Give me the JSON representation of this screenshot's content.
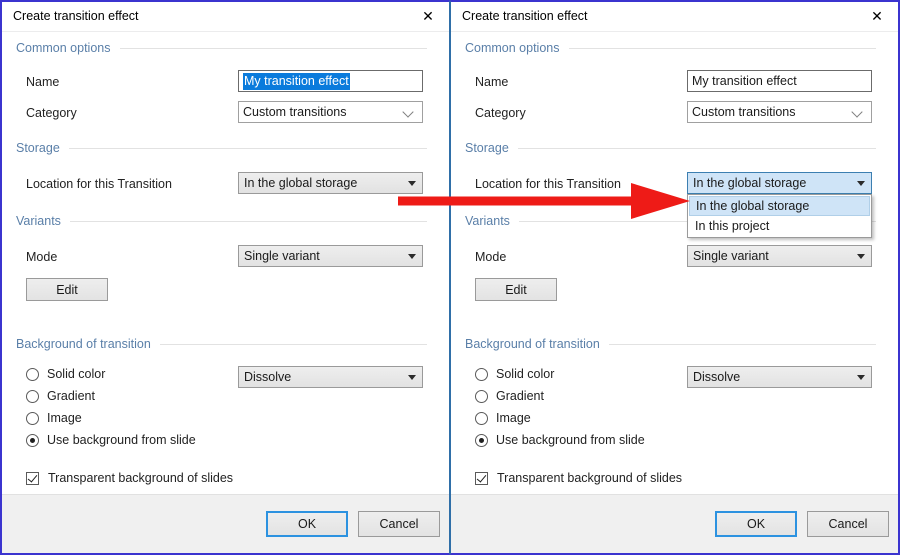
{
  "panels": [
    {
      "id": "left",
      "title": "Create transition effect",
      "close_icon": "✕",
      "sections": {
        "common": "Common options",
        "storage": "Storage",
        "variants": "Variants",
        "background": "Background of transition"
      },
      "fields": {
        "name_label": "Name",
        "name_value": "My transition effect",
        "name_selected": true,
        "category_label": "Category",
        "category_value": "Custom transitions",
        "location_label": "Location for this Transition",
        "location_value": "In the global storage",
        "mode_label": "Mode",
        "mode_value": "Single variant",
        "edit_label": "Edit",
        "effect_value": "Dissolve"
      },
      "radios": [
        {
          "label": "Solid color",
          "selected": false
        },
        {
          "label": "Gradient",
          "selected": false
        },
        {
          "label": "Image",
          "selected": false
        },
        {
          "label": "Use background from slide",
          "selected": true
        }
      ],
      "checkbox": {
        "label": "Transparent background of slides",
        "checked": true
      },
      "buttons": {
        "ok": "OK",
        "cancel": "Cancel"
      },
      "dropdown_open": false
    },
    {
      "id": "right",
      "title": "Create transition effect",
      "close_icon": "✕",
      "sections": {
        "common": "Common options",
        "storage": "Storage",
        "variants": "Variants",
        "background": "Background of transition"
      },
      "fields": {
        "name_label": "Name",
        "name_value": "My transition effect",
        "name_selected": false,
        "category_label": "Category",
        "category_value": "Custom transitions",
        "location_label": "Location for this Transition",
        "location_value": "In the global storage",
        "mode_label": "Mode",
        "mode_value": "Single variant",
        "edit_label": "Edit",
        "effect_value": "Dissolve"
      },
      "radios": [
        {
          "label": "Solid color",
          "selected": false
        },
        {
          "label": "Gradient",
          "selected": false
        },
        {
          "label": "Image",
          "selected": false
        },
        {
          "label": "Use background from slide",
          "selected": true
        }
      ],
      "checkbox": {
        "label": "Transparent background of slides",
        "checked": true
      },
      "buttons": {
        "ok": "OK",
        "cancel": "Cancel"
      },
      "dropdown_open": true,
      "location_options": [
        {
          "label": "In the global storage",
          "selected": true
        },
        {
          "label": "In this project",
          "selected": false
        }
      ]
    }
  ],
  "annotation": {
    "arrow_color": "#ee1b17",
    "arrow_name": "red-pointer-arrow"
  },
  "colors": {
    "window_border": "#3b34cf",
    "section_header": "#5a7fa8",
    "selection_blue": "#0a7bdc",
    "focus_blue": "#2c92e0",
    "dropdown_open_fill": "#cfe4f7",
    "footer_gray": "#f0f0f0"
  }
}
